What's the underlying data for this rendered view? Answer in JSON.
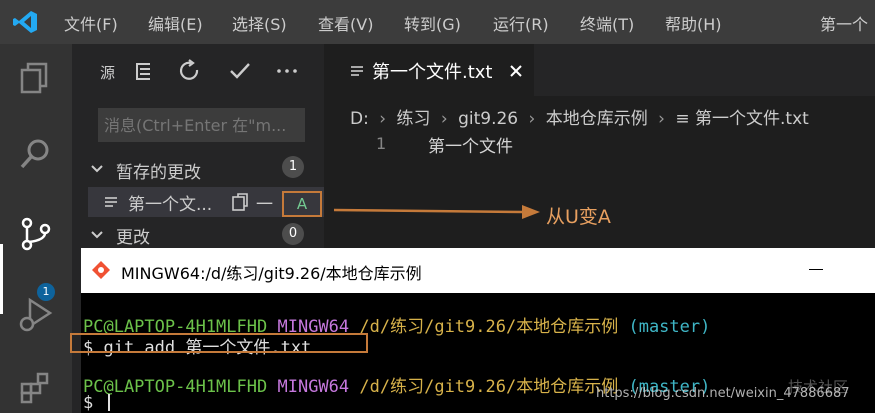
{
  "menubar": {
    "items": [
      "文件(F)",
      "编辑(E)",
      "选择(S)",
      "查看(V)",
      "转到(G)",
      "运行(R)",
      "终端(T)",
      "帮助(H)"
    ],
    "window_title": "第一个"
  },
  "activity": {
    "scm_badge": "1"
  },
  "sidebar": {
    "title": "源",
    "message_placeholder": "消息(Ctrl+Enter 在\"m...",
    "staged_label": "暂存的更改",
    "staged_count": "1",
    "staged_file": "第一个文...",
    "staged_file_extra": "一",
    "staged_file_status": "A",
    "changes_label": "更改",
    "changes_count": "0"
  },
  "editor": {
    "tab_label": "第一个文件.txt",
    "breadcrumb": [
      "D:",
      "练习",
      "git9.26",
      "本地仓库示例",
      "第一个文件.txt"
    ],
    "line_number": "1",
    "line_text": "第一个文件"
  },
  "annotation": {
    "text": "从U变A"
  },
  "terminal": {
    "title": "MINGW64:/d/练习/git9.26/本地仓库示例",
    "prompt1": {
      "user": "PC@LAPTOP-4H1MLFHD",
      "shell": "MINGW64",
      "path": "/d/练习/git9.26/本地仓库示例",
      "branch": "(master)"
    },
    "command": "$ git add 第一个文件.txt",
    "prompt2": {
      "user": "PC@LAPTOP-4H1MLFHD",
      "shell": "MINGW64",
      "path": "/d/练习/git9.26/本地仓库示例",
      "branch": "(master)"
    },
    "cursor_prompt": "$"
  },
  "watermark": {
    "text": "https://blog.csdn.net/weixin_47886687",
    "overlay_text": "技术社区"
  },
  "colors": {
    "accent": "#0e639c",
    "annotation": "#c57a3a",
    "added": "#73c991"
  }
}
